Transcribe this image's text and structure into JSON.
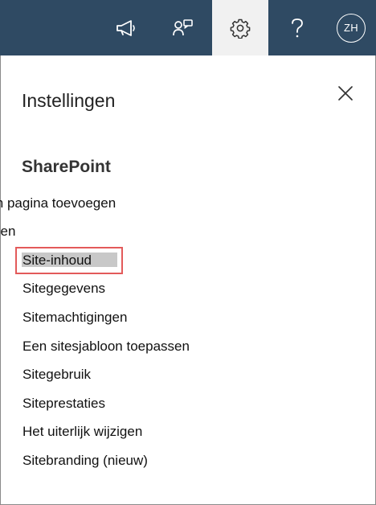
{
  "topbar": {
    "avatar_initials": "ZH",
    "icons": [
      "megaphone-icon",
      "feedback-icon",
      "gear-icon",
      "help-icon"
    ],
    "background_color": "#2f4a63"
  },
  "panel": {
    "title": "Instellingen",
    "section_title": "SharePoint",
    "clipped_items": [
      "Een pagina toevoegen",
      "Een app toevoegen"
    ],
    "items": [
      "Site-inhoud",
      "Sitegegevens",
      "Sitemachtigingen",
      "Een sitesjabloon toepassen",
      "Sitegebruik",
      "Siteprestaties",
      "Het uiterlijk wijzigen",
      "Sitebranding (nieuw)"
    ],
    "highlight_color": "#e35a5a"
  }
}
